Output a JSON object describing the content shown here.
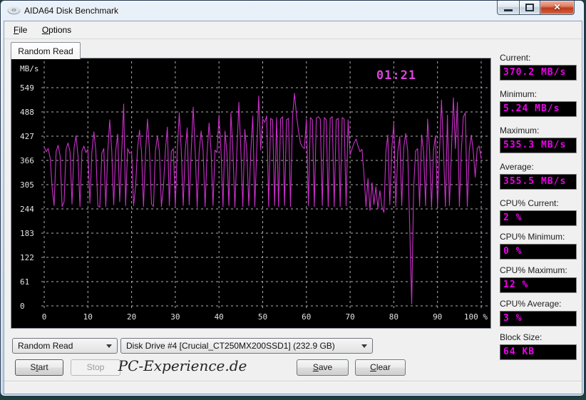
{
  "window": {
    "title": "AIDA64 Disk Benchmark"
  },
  "icons": {
    "close_glyph": "✕"
  },
  "menu": {
    "items": [
      {
        "pre": "",
        "key": "F",
        "post": "ile"
      },
      {
        "pre": "",
        "key": "O",
        "post": "ptions"
      }
    ]
  },
  "tab": {
    "label": "Random Read"
  },
  "stats": [
    {
      "label": "Current:",
      "value": "370.2 MB/s"
    },
    {
      "label": "Minimum:",
      "value": "5.24 MB/s"
    },
    {
      "label": "Maximum:",
      "value": "535.3 MB/s"
    },
    {
      "label": "Average:",
      "value": "355.5 MB/s"
    },
    {
      "label": "CPU% Current:",
      "value": "2 %"
    },
    {
      "label": "CPU% Minimum:",
      "value": "0 %"
    },
    {
      "label": "CPU% Maximum:",
      "value": "12 %"
    },
    {
      "label": "CPU% Average:",
      "value": "3 %"
    },
    {
      "label": "Block Size:",
      "value": "64 KB"
    }
  ],
  "controls": {
    "test_select": {
      "value": "Random Read"
    },
    "drive_select": {
      "value": "Disk Drive #4  [Crucial_CT250MX200SSD1]  (232.9 GB)"
    },
    "start": {
      "pre": "S",
      "key": "t",
      "post": "art"
    },
    "stop": {
      "pre": "",
      "key": "",
      "post": "Stop"
    },
    "save": {
      "pre": "",
      "key": "S",
      "post": "ave"
    },
    "clear": {
      "pre": "",
      "key": "C",
      "post": "lear"
    },
    "watermark": "PC-Experience.de"
  },
  "chart_data": {
    "type": "line",
    "title": "",
    "ylabel": "MB/s",
    "timer": "01:21",
    "y_ticks": [
      549,
      488,
      427,
      366,
      305,
      244,
      183,
      122,
      61,
      0
    ],
    "x_ticks": [
      0,
      10,
      20,
      30,
      40,
      50,
      60,
      70,
      80,
      90,
      100
    ],
    "x_unit_suffix": "%",
    "ylim": [
      0,
      610
    ],
    "xlim": [
      0,
      100
    ],
    "grid": true,
    "line_color": "#cb2fcb",
    "timer_color": "#d946d9",
    "axis_text_color": "#e2e2e2",
    "grid_color": "#b0b0b0",
    "values_mbps": [
      400,
      388,
      396,
      372,
      298,
      252,
      388,
      404,
      378,
      250,
      262,
      394,
      410,
      388,
      256,
      396,
      428,
      378,
      250,
      390,
      402,
      386,
      394,
      258,
      388,
      438,
      390,
      252,
      248,
      384,
      396,
      250,
      388,
      468,
      392,
      254,
      390,
      432,
      262,
      386,
      508,
      252,
      396,
      384,
      388,
      252,
      300,
      398,
      442,
      388,
      250,
      384,
      470,
      390,
      256,
      250,
      390,
      428,
      388,
      250,
      298,
      392,
      450,
      252,
      388,
      396,
      250,
      392,
      486,
      390,
      252,
      390,
      448,
      254,
      388,
      500,
      390,
      248,
      386,
      440,
      390,
      250,
      384,
      460,
      388,
      252,
      392,
      386,
      480,
      388,
      250,
      440,
      386,
      252,
      486,
      390,
      248,
      390,
      512,
      388,
      250,
      444,
      390,
      252,
      388,
      478,
      250,
      390,
      528,
      392,
      470,
      462,
      478,
      250,
      472,
      468,
      252,
      474,
      250,
      470,
      476,
      252,
      468,
      472,
      250,
      474,
      535,
      480,
      440,
      410,
      400,
      396,
      470,
      252,
      474,
      468,
      250,
      472,
      476,
      470,
      252,
      474,
      468,
      250,
      472,
      476,
      250,
      468,
      472,
      250,
      474,
      470,
      252,
      468,
      380,
      396,
      410,
      420,
      402,
      388,
      394,
      330,
      250,
      320,
      240,
      310,
      255,
      300,
      245,
      290,
      250,
      235,
      388,
      430,
      254,
      396,
      460,
      250,
      388,
      426,
      252,
      398,
      434,
      390,
      200,
      5,
      300,
      390,
      396,
      250,
      430,
      388,
      252,
      470,
      390,
      248,
      392,
      428,
      250,
      386,
      518,
      390,
      250,
      480,
      252,
      388,
      524,
      396,
      512,
      250,
      390,
      476,
      486,
      250,
      392,
      430,
      388,
      324,
      396,
      402,
      370
    ]
  }
}
